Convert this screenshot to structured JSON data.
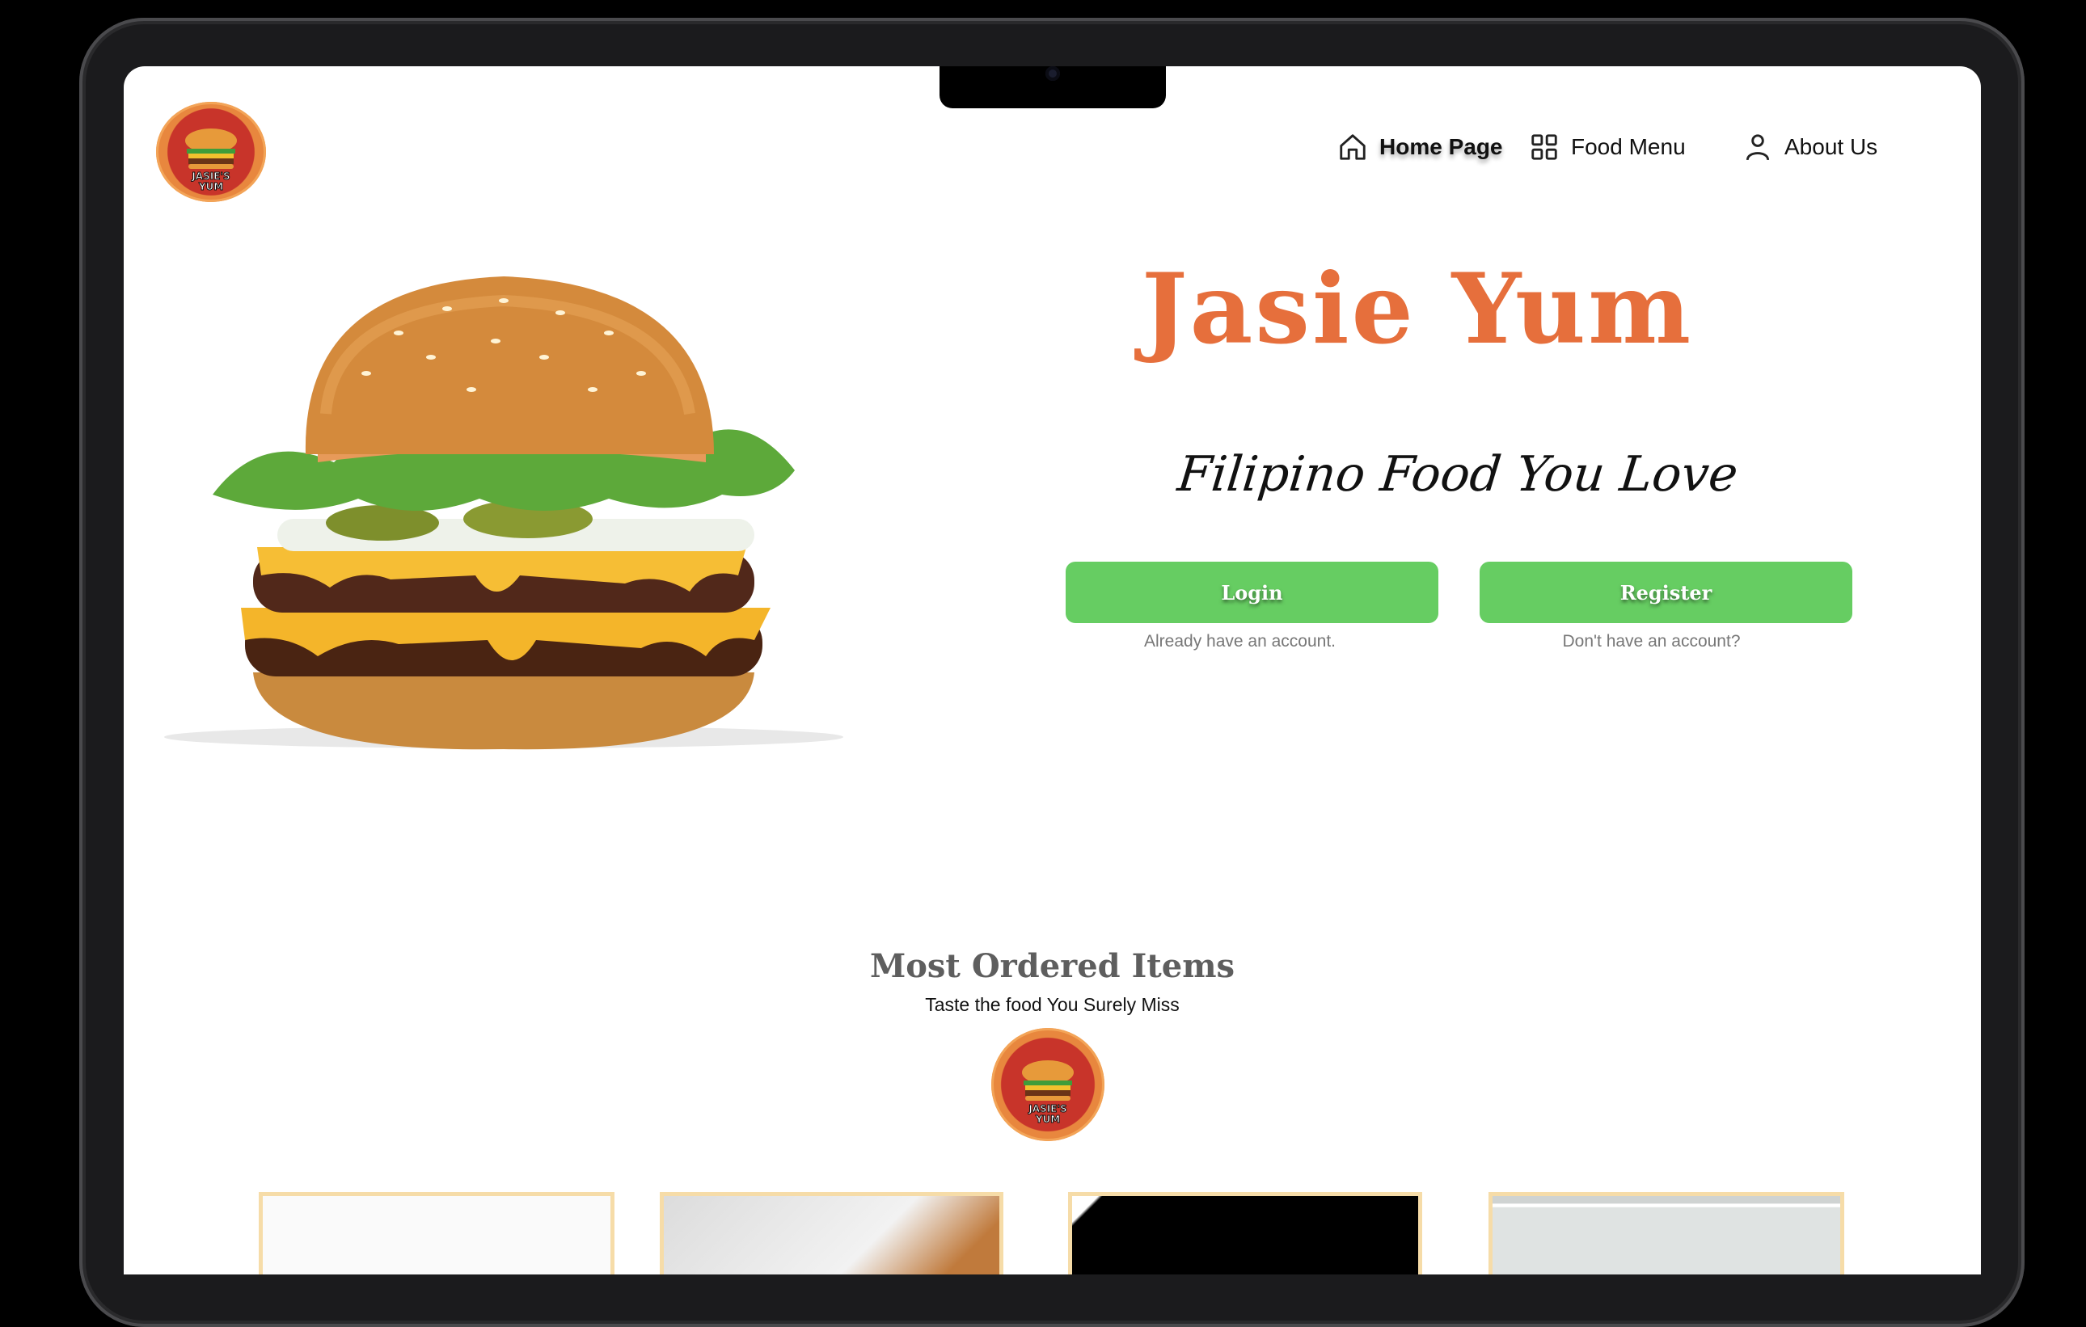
{
  "logo": {
    "line1": "JASIE'S",
    "line2": "YUM"
  },
  "nav": {
    "home": "Home Page",
    "menu": "Food Menu",
    "about": "About Us"
  },
  "hero": {
    "title": "Jasie Yum",
    "tagline": "Filipino Food You Love",
    "login_label": "Login",
    "register_label": "Register",
    "login_hint": "Already have an account.",
    "register_hint": "Don't have an account?"
  },
  "section": {
    "title": "Most Ordered  Items",
    "subtitle": "Taste the food You Surely Miss"
  },
  "colors": {
    "brand_orange": "#e66f3c",
    "button_green": "#66cd62",
    "card_border": "#f6dca8"
  }
}
